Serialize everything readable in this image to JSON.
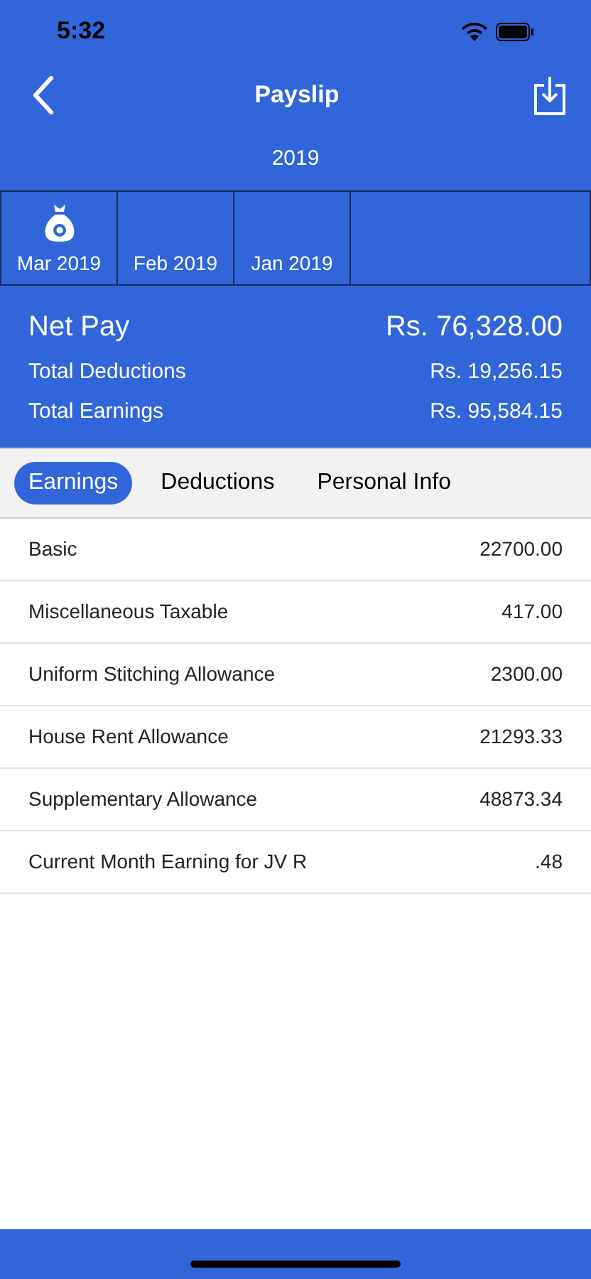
{
  "status_bar": {
    "time": "5:32"
  },
  "nav": {
    "title": "Payslip"
  },
  "year": "2019",
  "months": [
    {
      "label": "Mar 2019",
      "selected": true
    },
    {
      "label": "Feb 2019",
      "selected": false
    },
    {
      "label": "Jan 2019",
      "selected": false
    }
  ],
  "summary": {
    "net_pay_label": "Net Pay",
    "net_pay": "Rs. 76,328.00",
    "rows": [
      {
        "label": "Total Deductions",
        "value": "Rs. 19,256.15"
      },
      {
        "label": "Total Earnings",
        "value": "Rs. 95,584.15"
      }
    ]
  },
  "tabs": [
    {
      "label": "Earnings",
      "selected": true
    },
    {
      "label": "Deductions",
      "selected": false
    },
    {
      "label": "Personal Info",
      "selected": false
    }
  ],
  "items": [
    {
      "name": "Basic",
      "amount": "22700.00"
    },
    {
      "name": "Miscellaneous Taxable",
      "amount": "417.00"
    },
    {
      "name": "Uniform Stitching Allowance",
      "amount": "2300.00"
    },
    {
      "name": "House Rent Allowance",
      "amount": "21293.33"
    },
    {
      "name": "Supplementary Allowance",
      "amount": "48873.34"
    },
    {
      "name": "Current Month Earning for JV R",
      "amount": ".48"
    }
  ]
}
